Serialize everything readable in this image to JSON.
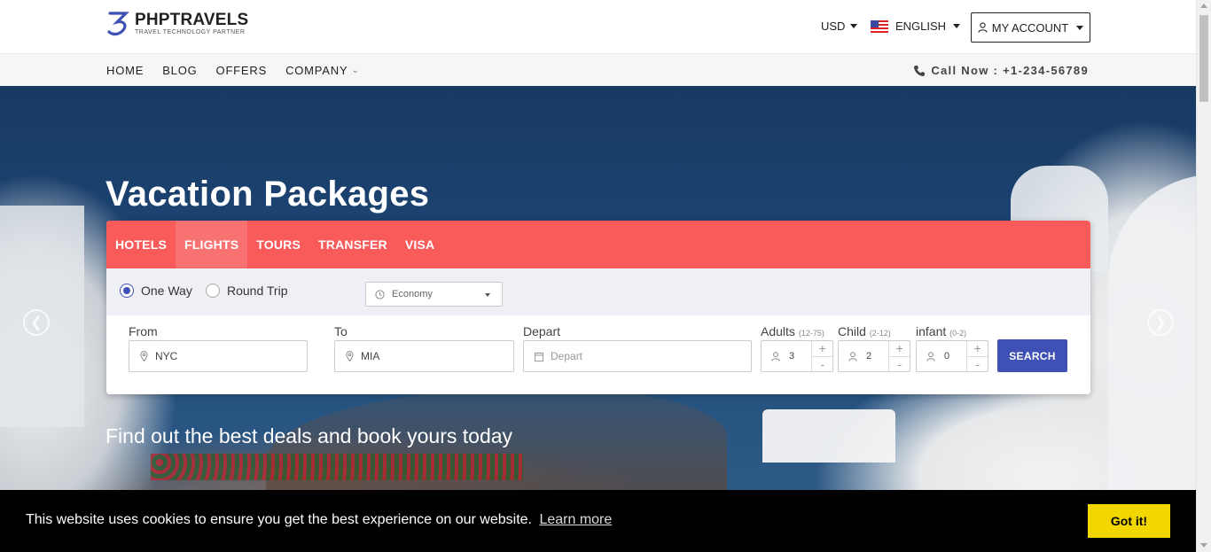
{
  "header": {
    "logo_name": "PHPTRAVELS",
    "logo_tagline": "TRAVEL TECHNOLOGY PARTNER",
    "currency": "USD",
    "language": "ENGLISH",
    "account_label": "MY ACCOUNT"
  },
  "nav": {
    "items": [
      {
        "label": "HOME"
      },
      {
        "label": "BLOG"
      },
      {
        "label": "OFFERS"
      },
      {
        "label": "COMPANY"
      }
    ],
    "call_now": "Call Now : +1-234-56789"
  },
  "hero": {
    "title": "Vacation Packages",
    "subtitle": "Find out the best deals and book yours today"
  },
  "search": {
    "tabs": [
      {
        "label": "HOTELS",
        "active": false
      },
      {
        "label": "FLIGHTS",
        "active": true
      },
      {
        "label": "TOURS",
        "active": false
      },
      {
        "label": "TRANSFER",
        "active": false
      },
      {
        "label": "VISA",
        "active": false
      }
    ],
    "trip_types": [
      {
        "label": "One Way",
        "selected": true
      },
      {
        "label": "Round Trip",
        "selected": false
      }
    ],
    "cabin_class": "Economy",
    "from_label": "From",
    "from_value": "NYC",
    "to_label": "To",
    "to_value": "MIA",
    "depart_label": "Depart",
    "depart_placeholder": "Depart",
    "adults_label": "Adults",
    "adults_range": "(12-75)",
    "adults_value": "3",
    "child_label": "Child",
    "child_range": "(2-12)",
    "child_value": "2",
    "infant_label": "infant",
    "infant_range": "(0-2)",
    "infant_value": "0",
    "plus": "+",
    "minus": "-",
    "search_label": "SEARCH"
  },
  "cookie": {
    "message": "This website uses cookies to ensure you get the best experience on our website.",
    "learn_more": "Learn more",
    "accept_label": "Got it!"
  },
  "colors": {
    "tab_bar": "#f95b5b",
    "primary": "#3f51b5",
    "cookie_button": "#f1d600"
  }
}
